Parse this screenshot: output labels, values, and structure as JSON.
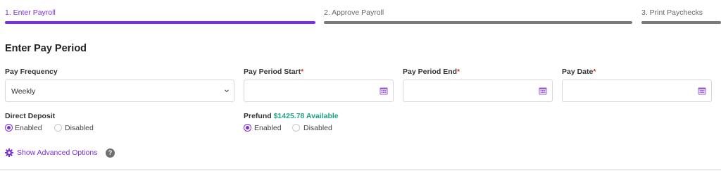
{
  "stepper": {
    "steps": [
      {
        "label": "1. Enter Payroll",
        "state": "active"
      },
      {
        "label": "2. Approve Payroll",
        "state": "inactive"
      },
      {
        "label": "3. Print Paychecks",
        "state": "inactive"
      }
    ]
  },
  "section": {
    "title": "Enter Pay Period"
  },
  "fields": {
    "pay_frequency": {
      "label": "Pay Frequency",
      "value": "Weekly"
    },
    "period_start": {
      "label": "Pay Period Start",
      "required": "*",
      "value": ""
    },
    "period_end": {
      "label": "Pay Period End",
      "required": "*",
      "value": ""
    },
    "pay_date": {
      "label": "Pay Date",
      "required": "*",
      "value": ""
    }
  },
  "direct_deposit": {
    "label": "Direct Deposit",
    "options": [
      "Enabled",
      "Disabled"
    ],
    "selected": "Enabled"
  },
  "prefund": {
    "label": "Prefund",
    "available": "$1425.78 Available",
    "options": [
      "Enabled",
      "Disabled"
    ],
    "selected": "Enabled"
  },
  "advanced": {
    "label": "Show Advanced Options",
    "help": "?"
  },
  "colors": {
    "accent": "#7b2fd6",
    "available": "#1fa38a",
    "required": "#d9302c"
  },
  "icons": [
    "chevron-down-icon",
    "calendar-icon",
    "gear-icon",
    "help-icon"
  ]
}
